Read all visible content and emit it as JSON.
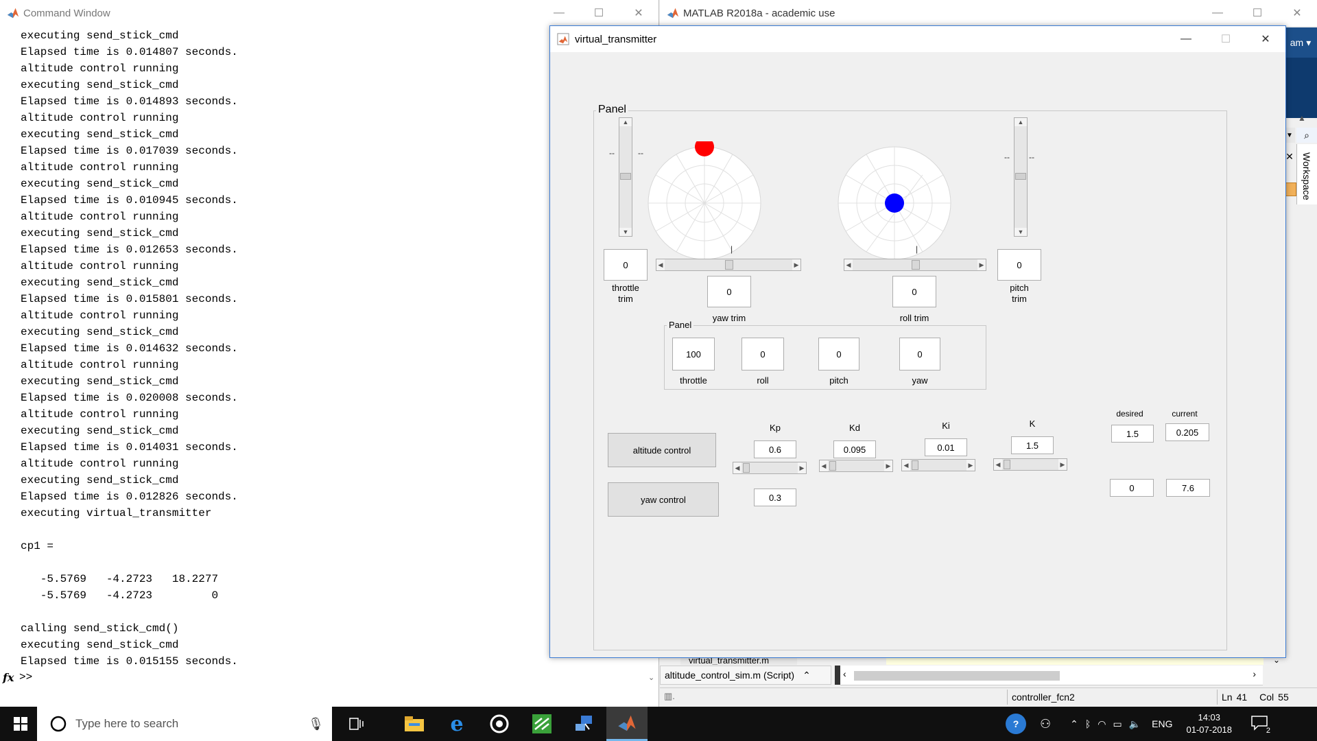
{
  "command_window": {
    "title": "Command Window",
    "lines": [
      "executing send_stick_cmd",
      "Elapsed time is 0.014807 seconds.",
      "altitude control running",
      "executing send_stick_cmd",
      "Elapsed time is 0.014893 seconds.",
      "altitude control running",
      "executing send_stick_cmd",
      "Elapsed time is 0.017039 seconds.",
      "altitude control running",
      "executing send_stick_cmd",
      "Elapsed time is 0.010945 seconds.",
      "altitude control running",
      "executing send_stick_cmd",
      "Elapsed time is 0.012653 seconds.",
      "altitude control running",
      "executing send_stick_cmd",
      "Elapsed time is 0.015801 seconds.",
      "altitude control running",
      "executing send_stick_cmd",
      "Elapsed time is 0.014632 seconds.",
      "altitude control running",
      "executing send_stick_cmd",
      "Elapsed time is 0.020008 seconds.",
      "altitude control running",
      "executing send_stick_cmd",
      "Elapsed time is 0.014031 seconds.",
      "altitude control running",
      "executing send_stick_cmd",
      "Elapsed time is 0.012826 seconds.",
      "executing virtual_transmitter",
      "",
      "cp1 =",
      "",
      "   -5.5769   -4.2723   18.2277",
      "   -5.5769   -4.2723         0",
      "",
      "calling send_stick_cmd()",
      "executing send_stick_cmd",
      "Elapsed time is 0.015155 seconds."
    ],
    "prompt": ">>",
    "fx": "fx"
  },
  "matlab": {
    "title": "MATLAB R2018a - academic use",
    "user_menu": "am",
    "workspace_tab": "Workspace",
    "file_tab_1": "virtual_transmitter.m",
    "file_tab_2": "altitude_control_sim.m  (Script)",
    "status_func": "controller_fcn2",
    "status_ln_label": "Ln",
    "status_ln": "41",
    "status_col_label": "Col",
    "status_col": "55"
  },
  "figure": {
    "title": "virtual_transmitter",
    "panel_label": "Panel",
    "inner_panel_label": "Panel",
    "stick_left_dot_color": "#ff0000",
    "stick_right_dot_color": "#0000ff",
    "throttle_trim": {
      "value": "0",
      "label": "throttle\ntrim"
    },
    "yaw_trim": {
      "value": "0",
      "label": "yaw trim"
    },
    "roll_trim": {
      "value": "0",
      "label": "roll trim"
    },
    "pitch_trim": {
      "value": "0",
      "label": "pitch\ntrim"
    },
    "dash": "--",
    "channels": [
      {
        "label": "throttle",
        "value": "100"
      },
      {
        "label": "roll",
        "value": "0"
      },
      {
        "label": "pitch",
        "value": "0"
      },
      {
        "label": "yaw",
        "value": "0"
      }
    ],
    "altitude_button": "altitude control",
    "yaw_button": "yaw control",
    "gains": [
      {
        "label": "Kp",
        "value": "0.6"
      },
      {
        "label": "Kd",
        "value": "0.095"
      },
      {
        "label": "Ki",
        "value": "0.01"
      },
      {
        "label": "K",
        "value": "1.5"
      }
    ],
    "yaw_gain": "0.3",
    "desired_label": "desired",
    "current_label": "current",
    "desired_alt": "1.5",
    "current_alt": "0.205",
    "desired_yaw": "0",
    "current_yaw": "7.6"
  },
  "taskbar": {
    "search_placeholder": "Type here to search",
    "lang": "ENG",
    "time": "14:03",
    "date": "01-07-2018",
    "notif_count": "2"
  }
}
